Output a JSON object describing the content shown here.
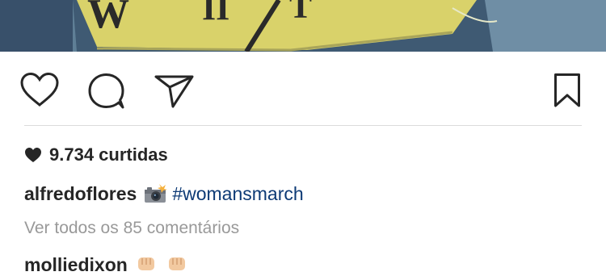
{
  "post": {
    "photo_icon": "photo-image",
    "actions": {
      "like_icon": "heart-outline-icon",
      "comment_icon": "speech-bubble-icon",
      "share_icon": "paper-plane-icon",
      "save_icon": "bookmark-icon"
    },
    "likes": {
      "icon": "heart-filled-icon",
      "text": "9.734 curtidas"
    },
    "caption": {
      "username": "alfredoflores",
      "emoji": "camera-with-flash",
      "hashtag": "#womansmarch"
    },
    "view_comments": "Ver todos os 85 comentários",
    "comments": [
      {
        "username": "molliedixon",
        "emojis": [
          "raised-fist",
          "raised-fist"
        ]
      }
    ]
  },
  "colors": {
    "text": "#262626",
    "muted": "#999999",
    "hashtag": "#0d3a75",
    "divider": "#dbdbdb"
  }
}
